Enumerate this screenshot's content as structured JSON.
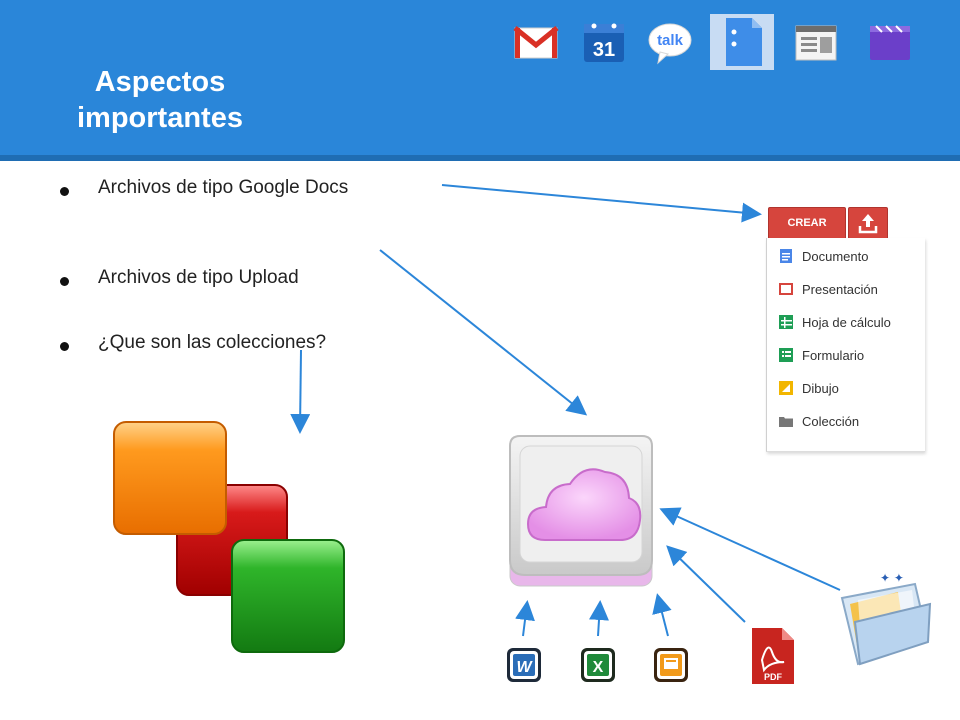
{
  "slide": {
    "title_line1": "Aspectos",
    "title_line2": "importantes"
  },
  "apps": [
    {
      "name": "gmail-icon"
    },
    {
      "name": "calendar-icon",
      "label": "31"
    },
    {
      "name": "talk-icon",
      "label": "talk"
    },
    {
      "name": "docs-icon"
    },
    {
      "name": "sites-icon"
    },
    {
      "name": "video-icon"
    }
  ],
  "bullets": [
    "Archivos de tipo Google Docs",
    "Archivos de tipo Upload",
    "¿Que son las colecciones?"
  ],
  "docs_menu": {
    "create_label": "CREAR",
    "items": [
      {
        "label": "Documento",
        "color": "#4a86e8"
      },
      {
        "label": "Presentación",
        "color": "#d6453d"
      },
      {
        "label": "Hoja de cálculo",
        "color": "#1e9e55"
      },
      {
        "label": "Formulario",
        "color": "#1e9e55"
      },
      {
        "label": "Dibujo",
        "color": "#f2b600"
      },
      {
        "label": "Colección",
        "color": "#777777"
      }
    ]
  },
  "file_icons": [
    {
      "name": "word-icon",
      "label": "W",
      "color": "#2a6db8"
    },
    {
      "name": "excel-icon",
      "label": "X",
      "color": "#1f8a3a"
    },
    {
      "name": "powerpoint-icon",
      "color": "#e07a10"
    },
    {
      "name": "pdf-icon",
      "label": "PDF",
      "color": "#c8251f"
    }
  ],
  "colors": {
    "header": "#2a86d9",
    "arrow": "#2c86d9"
  }
}
